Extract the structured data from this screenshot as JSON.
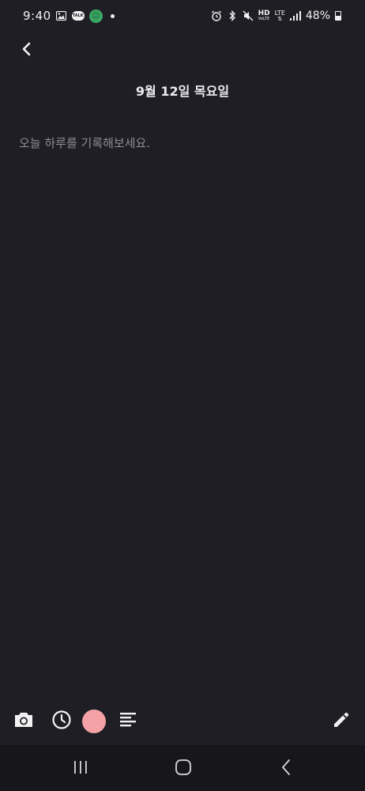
{
  "status_bar": {
    "time": "9:40",
    "talk_badge": "TALK",
    "hd": "HD",
    "lte": "LTE",
    "battery": "48%"
  },
  "header": {
    "title": "9월 12일 목요일",
    "back_icon": "chevron-left-icon"
  },
  "editor": {
    "placeholder": "오늘 하루를 기록해보세요.",
    "value": ""
  },
  "toolbar": {
    "items": [
      "camera-icon",
      "clock-icon",
      "color-swatch",
      "align-left-icon",
      "pencil-icon"
    ],
    "selected_color": "#f4a2a6"
  },
  "nav": {
    "items": [
      "recent-apps-icon",
      "home-icon",
      "back-icon"
    ]
  },
  "colors": {
    "background": "#1f1e24",
    "nav_background": "#17171b",
    "text": "#ececf0",
    "placeholder": "#8e8d94",
    "accent_pink": "#f4a2a6"
  }
}
